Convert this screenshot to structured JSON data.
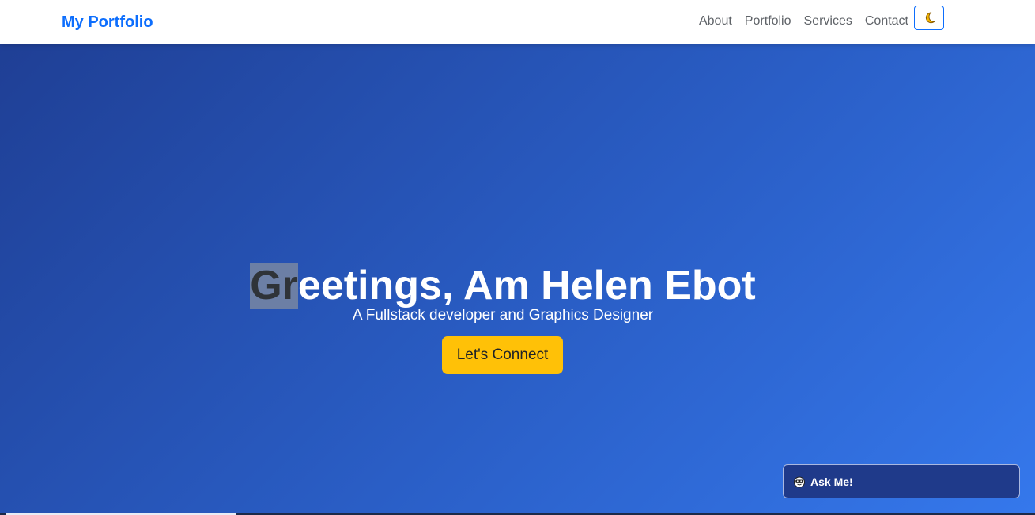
{
  "navbar": {
    "brand": "My Portfolio",
    "links": [
      "About",
      "Portfolio",
      "Services",
      "Contact"
    ],
    "theme_toggle_icon": "moon-icon"
  },
  "hero": {
    "title_highlight": "Gr",
    "title_rest": "eetings, Am Helen Ebot",
    "subtitle": "A Fullstack developer and Graphics Designer",
    "cta_label": "Let's Connect"
  },
  "chat": {
    "label": "Ask Me!",
    "icon": "bot-icon"
  },
  "colors": {
    "brand": "#0d6efd",
    "hero_start": "#1f3f95",
    "hero_end": "#3578ec",
    "cta": "#ffc107",
    "chat_bg": "#1f3a8a"
  }
}
